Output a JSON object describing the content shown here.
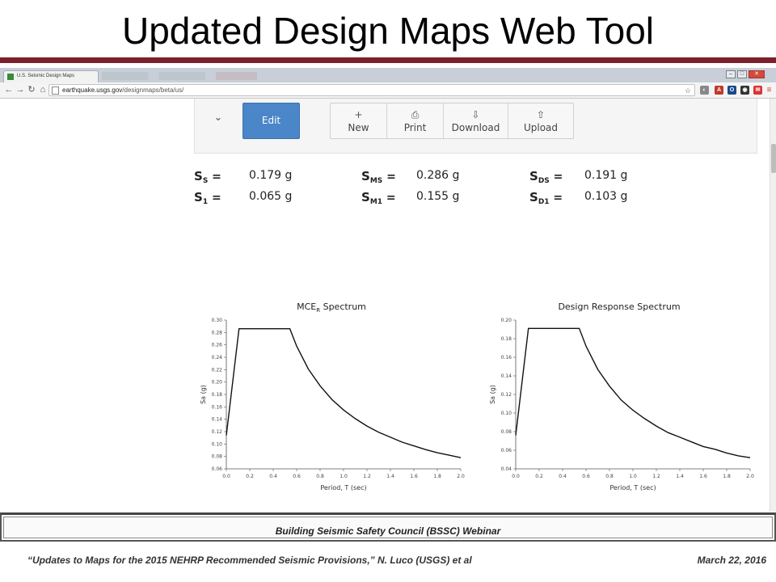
{
  "slide": {
    "title": "Updated Design Maps Web Tool",
    "footer_banner": "Building Seismic Safety Council (BSSC) Webinar",
    "citation": "“Updates to Maps for the 2015 NEHRP Recommended Seismic Provisions,” N. Luco (USGS) et al",
    "date": "March 22, 2016",
    "accent_color": "#7a1f2b"
  },
  "browser": {
    "tab_title": "U.S. Seismic Design Maps",
    "url_host": "earthquake.usgs.gov",
    "url_path": "/designmaps/beta/us/",
    "nav_icons": [
      "back-arrow-icon",
      "forward-arrow-icon",
      "reload-icon",
      "home-icon"
    ],
    "window_controls": [
      "minimize-icon",
      "maximize-icon",
      "close-icon"
    ]
  },
  "toolbar": {
    "collapse_icon": "chevron-down-icon",
    "edit_label": "Edit",
    "buttons": [
      {
        "icon": "+",
        "icon_name": "plus-icon",
        "label": "New"
      },
      {
        "icon": "⎙",
        "icon_name": "print-icon",
        "label": "Print"
      },
      {
        "icon": "⇩",
        "icon_name": "download-icon",
        "label": "Download"
      },
      {
        "icon": "⇧",
        "icon_name": "upload-icon",
        "label": "Upload"
      }
    ],
    "edit_color": "#4a86c8"
  },
  "parameters": [
    {
      "symbol": "S",
      "sub": "S",
      "eq": "=",
      "value": "0.179 g"
    },
    {
      "symbol": "S",
      "sub": "MS",
      "eq": "=",
      "value": "0.286 g"
    },
    {
      "symbol": "S",
      "sub": "DS",
      "eq": "=",
      "value": "0.191 g"
    },
    {
      "symbol": "S",
      "sub": "1",
      "eq": "=",
      "value": "0.065 g"
    },
    {
      "symbol": "S",
      "sub": "M1",
      "eq": "=",
      "value": "0.155 g"
    },
    {
      "symbol": "S",
      "sub": "D1",
      "eq": "=",
      "value": "0.103 g"
    }
  ],
  "chart_data": [
    {
      "type": "line",
      "title_main": "MCE",
      "title_sub": "R",
      "title_rest": " Spectrum",
      "xlabel": "Period, T (sec)",
      "ylabel": "Sa (g)",
      "xlim": [
        0.0,
        2.0
      ],
      "ylim": [
        0.06,
        0.3
      ],
      "xticks": [
        "0.0",
        "0.2",
        "0.4",
        "0.6",
        "0.8",
        "1.0",
        "1.2",
        "1.4",
        "1.6",
        "1.8",
        "2.0"
      ],
      "yticks": [
        "0.06",
        "0.08",
        "0.10",
        "0.12",
        "0.14",
        "0.16",
        "0.18",
        "0.20",
        "0.22",
        "0.24",
        "0.26",
        "0.28",
        "0.30"
      ],
      "series": [
        {
          "x": [
            0.0,
            0.108,
            0.542,
            0.6,
            0.7,
            0.8,
            0.9,
            1.0,
            1.1,
            1.2,
            1.3,
            1.4,
            1.5,
            1.6,
            1.7,
            1.8,
            1.9,
            2.0
          ],
          "y": [
            0.114,
            0.286,
            0.286,
            0.258,
            0.221,
            0.194,
            0.172,
            0.155,
            0.141,
            0.129,
            0.119,
            0.111,
            0.103,
            0.097,
            0.091,
            0.086,
            0.082,
            0.078
          ]
        }
      ],
      "grid": false
    },
    {
      "type": "line",
      "title_main": "Design Response Spectrum",
      "title_sub": "",
      "title_rest": "",
      "xlabel": "Period, T (sec)",
      "ylabel": "Sa (g)",
      "xlim": [
        0.0,
        2.0
      ],
      "ylim": [
        0.04,
        0.2
      ],
      "xticks": [
        "0.0",
        "0.2",
        "0.4",
        "0.6",
        "0.8",
        "1.0",
        "1.2",
        "1.4",
        "1.6",
        "1.8",
        "2.0"
      ],
      "yticks": [
        "0.04",
        "0.06",
        "0.08",
        "0.10",
        "0.12",
        "0.14",
        "0.16",
        "0.18",
        "0.20"
      ],
      "series": [
        {
          "x": [
            0.0,
            0.108,
            0.542,
            0.6,
            0.7,
            0.8,
            0.9,
            1.0,
            1.1,
            1.2,
            1.3,
            1.4,
            1.5,
            1.6,
            1.7,
            1.8,
            1.9,
            2.0
          ],
          "y": [
            0.076,
            0.191,
            0.191,
            0.172,
            0.147,
            0.129,
            0.114,
            0.103,
            0.094,
            0.086,
            0.079,
            0.074,
            0.069,
            0.064,
            0.061,
            0.057,
            0.054,
            0.052
          ]
        }
      ],
      "grid": false
    }
  ]
}
